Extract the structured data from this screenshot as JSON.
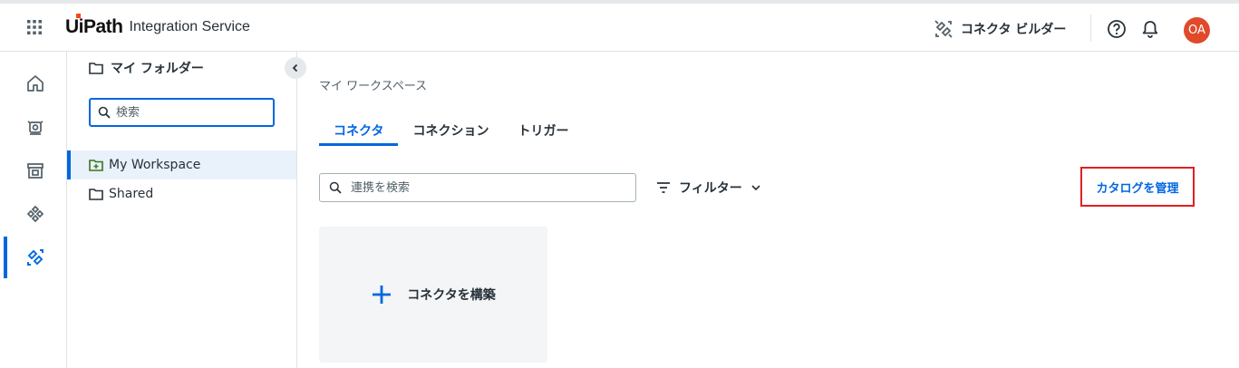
{
  "header": {
    "brand_logo": "UiPath",
    "brand_name": "Integration Service",
    "connector_builder_label": "コネクタ ビルダー",
    "avatar_initials": "OA",
    "avatar_color": "#e04a2a"
  },
  "nav_rail": {
    "items": [
      {
        "icon": "home-icon"
      },
      {
        "icon": "robot-icon"
      },
      {
        "icon": "store-icon"
      },
      {
        "icon": "integration-icon"
      },
      {
        "icon": "connector-icon",
        "active": true
      }
    ]
  },
  "folders": {
    "title": "マイ フォルダー",
    "search_placeholder": "検索",
    "items": [
      {
        "label": "My Workspace",
        "selected": true
      },
      {
        "label": "Shared",
        "selected": false
      }
    ]
  },
  "main": {
    "breadcrumb": "マイ ワークスペース",
    "tabs": [
      {
        "label": "コネクタ",
        "active": true
      },
      {
        "label": "コネクション",
        "active": false
      },
      {
        "label": "トリガー",
        "active": false
      }
    ],
    "search_placeholder": "連携を検索",
    "filter_label": "フィルター",
    "manage_catalog_label": "カタログを管理",
    "build_connector_label": "コネクタを構築"
  },
  "colors": {
    "accent": "#0067df",
    "highlight_border": "#e02020",
    "logo_dot": "#fa4616"
  }
}
